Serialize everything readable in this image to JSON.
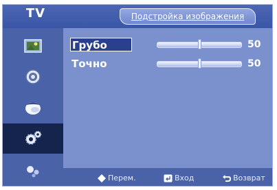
{
  "header": {
    "tv_label": "TV",
    "title": "Подстройка изображения"
  },
  "sidebar": {
    "items": [
      {
        "icon": "picture-icon",
        "active": false
      },
      {
        "icon": "sound-icon",
        "active": false
      },
      {
        "icon": "channel-icon",
        "active": false
      },
      {
        "icon": "setup-icon",
        "active": true
      },
      {
        "icon": "input-icon",
        "active": false
      }
    ]
  },
  "settings": {
    "rows": [
      {
        "label": "Грубо",
        "value": "50",
        "level": 0.5,
        "selected": true
      },
      {
        "label": "Точно",
        "value": "50",
        "level": 0.5,
        "selected": false
      }
    ]
  },
  "footer": {
    "move": "Перем.",
    "enter": "Вход",
    "return": "Возврат"
  },
  "colors": {
    "osd_bg": "#6d88c8",
    "header": "#3a56a6",
    "sidebar": "#4a62a8",
    "active_item": "#15244d"
  }
}
